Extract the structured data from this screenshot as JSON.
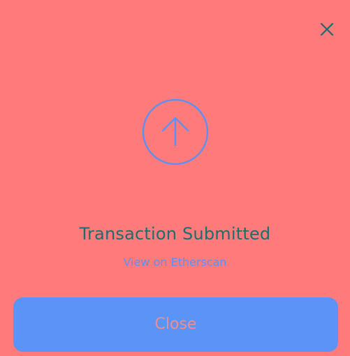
{
  "modal": {
    "close_icon": "close-icon",
    "status_icon": "arrow-up-circle-icon",
    "title": "Transaction Submitted",
    "explorer_link": "View on Etherscan",
    "close_button_label": "Close"
  },
  "colors": {
    "background": "#FF7A7A",
    "title_text": "#1B6E6E",
    "accent": "#5B93F7",
    "link_text": "#5C91F2",
    "button_text": "#F08E8E",
    "close_icon": "#1B6E6E"
  }
}
